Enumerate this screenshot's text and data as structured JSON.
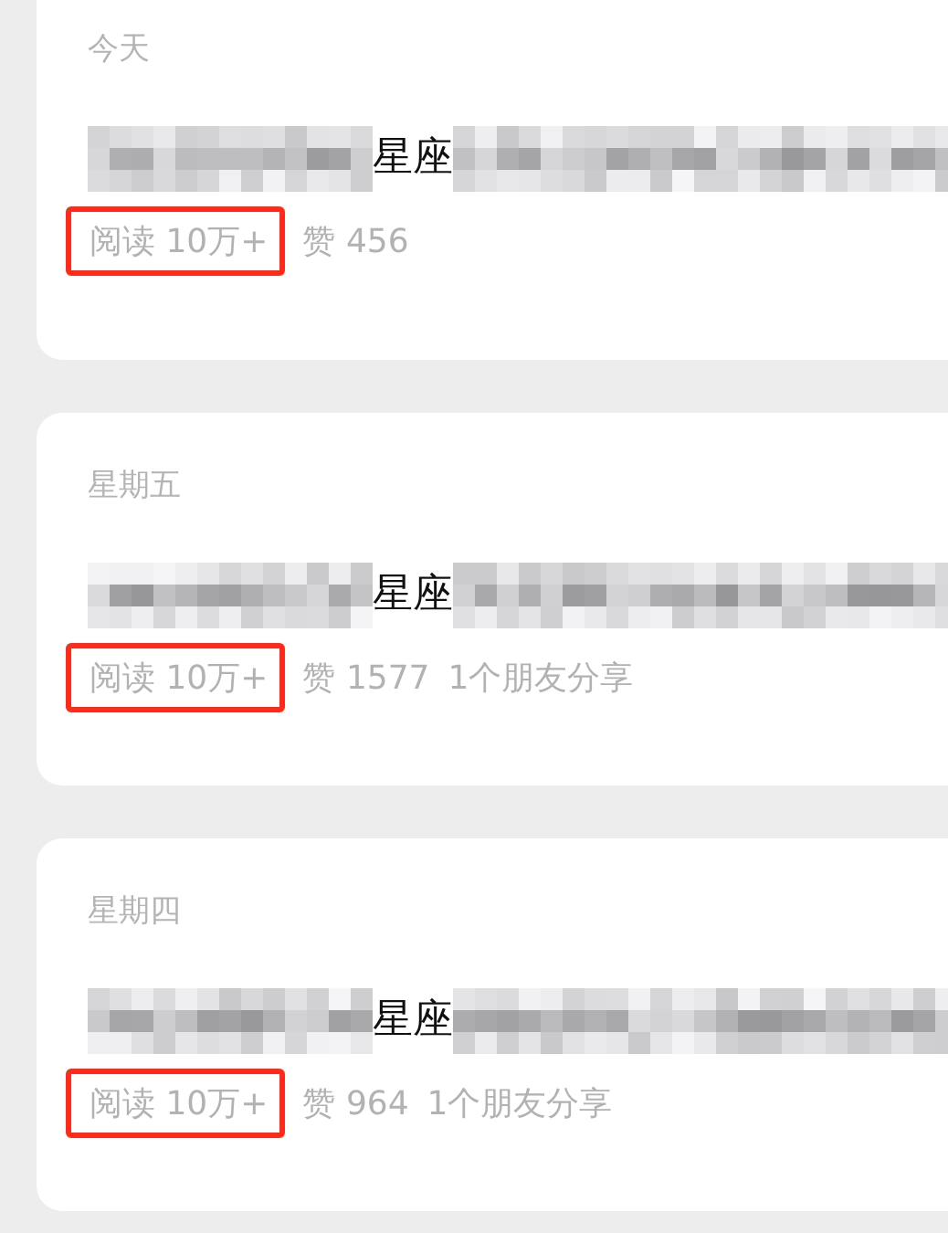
{
  "articles": [
    {
      "date": "今天",
      "title": "星座",
      "reads": "阅读 10万+",
      "reads_highlighted": true,
      "likes": "赞 456"
    },
    {
      "date": "星期五",
      "title": "星座",
      "reads": "阅读 10万+",
      "reads_highlighted": true,
      "likes": "赞 1577",
      "shares": "1个朋友分享"
    },
    {
      "date": "星期四",
      "title": "星座",
      "reads": "阅读 10万+",
      "reads_highlighted": true,
      "likes": "赞 964",
      "shares": "1个朋友分享"
    }
  ]
}
